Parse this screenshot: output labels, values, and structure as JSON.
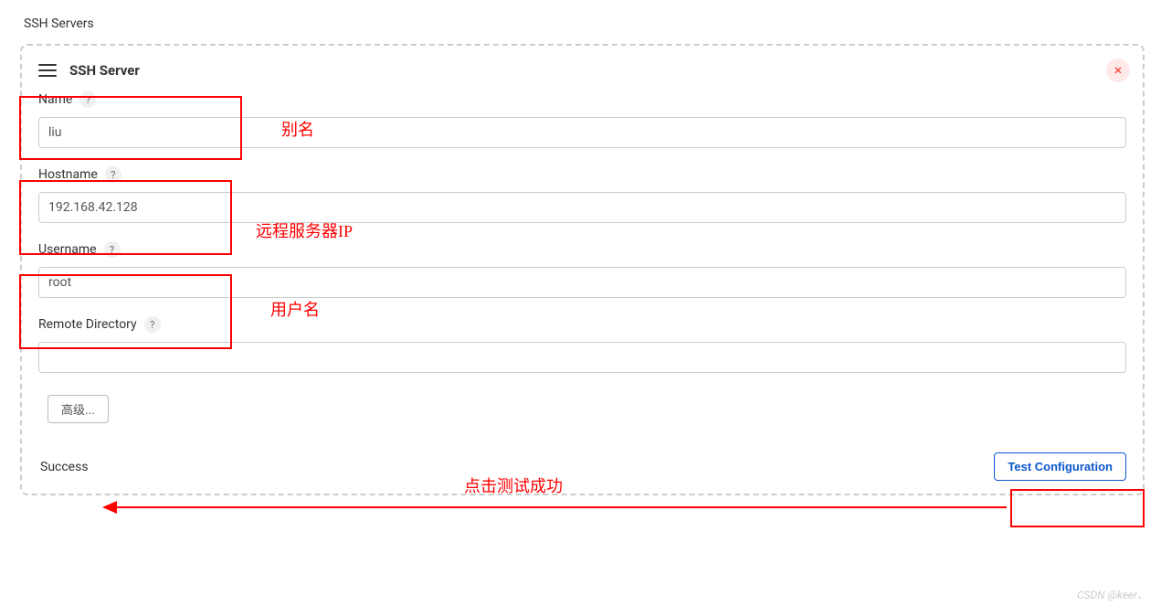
{
  "section": {
    "title": "SSH Servers"
  },
  "panel": {
    "title": "SSH Server",
    "close_label": "×"
  },
  "fields": {
    "name": {
      "label": "Name",
      "value": "liu"
    },
    "hostname": {
      "label": "Hostname",
      "value": "192.168.42.128"
    },
    "username": {
      "label": "Username",
      "value": "root"
    },
    "remote_directory": {
      "label": "Remote Directory",
      "value": ""
    }
  },
  "help_icon": "?",
  "buttons": {
    "advanced": "高级...",
    "test_configuration": "Test Configuration"
  },
  "status": {
    "message": "Success"
  },
  "annotations": {
    "alias": "别名",
    "remote_ip": "远程服务器IP",
    "username": "用户名",
    "click_test": "点击测试成功"
  },
  "watermark": "CSDN @keer、"
}
